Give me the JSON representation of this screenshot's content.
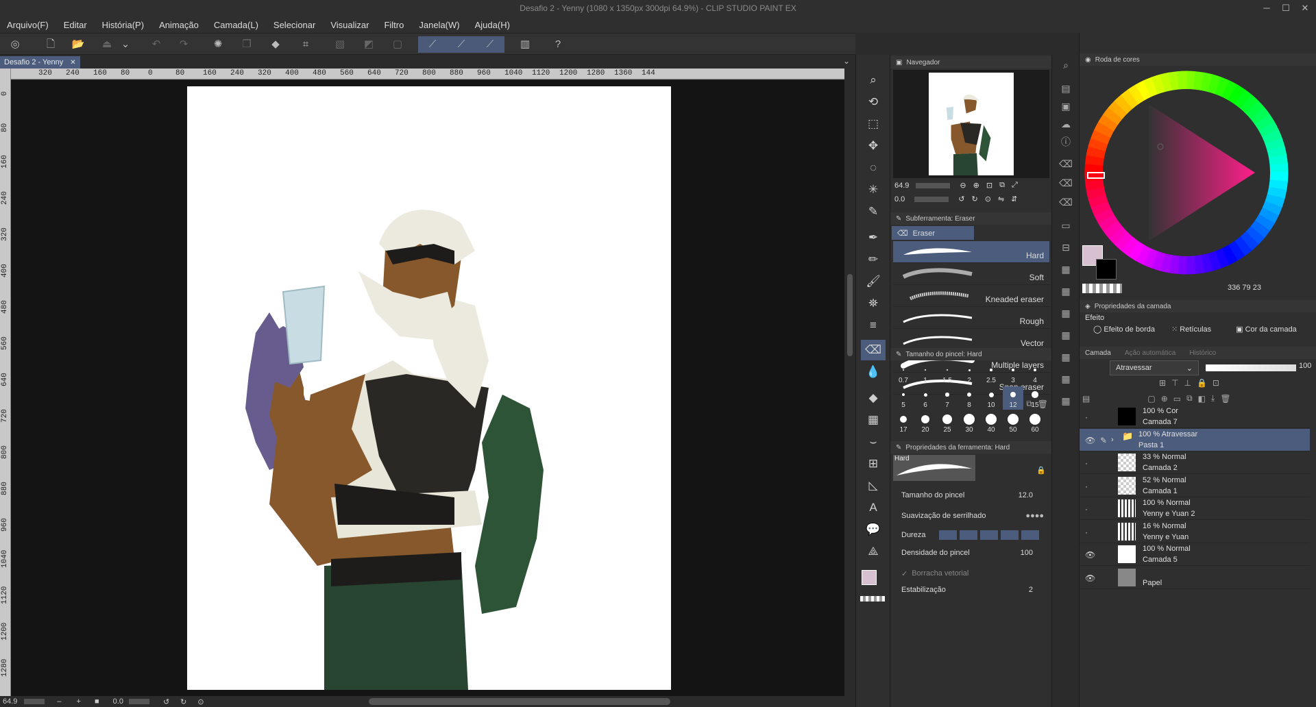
{
  "app": {
    "title": "Desafio 2 - Yenny (1080 x 1350px 300dpi 64.9%) - CLIP STUDIO PAINT EX"
  },
  "window_controls": {
    "minimize": "─",
    "maximize": "☐",
    "close": "✕"
  },
  "menu": [
    "Arquivo(F)",
    "Editar",
    "História(P)",
    "Animação",
    "Camada(L)",
    "Selecionar",
    "Visualizar",
    "Filtro",
    "Janela(W)",
    "Ajuda(H)"
  ],
  "document_tab": {
    "label": "Desafio 2 - Yenny",
    "close": "✕"
  },
  "ruler": {
    "h_labels": [
      "320",
      "240",
      "160",
      "80",
      "0",
      "80",
      "160",
      "240",
      "320",
      "400",
      "480",
      "560",
      "640",
      "720",
      "800",
      "880",
      "960",
      "1040",
      "1120",
      "1200",
      "1280",
      "1360",
      "144"
    ],
    "v_labels": [
      "0",
      "80",
      "160",
      "240",
      "320",
      "400",
      "480",
      "560",
      "640",
      "720",
      "800",
      "880",
      "960",
      "1040",
      "1120",
      "1200",
      "1280"
    ]
  },
  "status": {
    "zoom": "64.9",
    "minus": "–",
    "plus": "+",
    "angle": "0.0"
  },
  "navigator": {
    "title": "Navegador",
    "zoom": "64.9",
    "rotation": "0.0"
  },
  "subtool": {
    "title": "Subferramenta: Eraser",
    "group": "Eraser",
    "items": [
      "Hard",
      "Soft",
      "Kneaded eraser",
      "Rough",
      "Vector",
      "Multiple layers",
      "Snap eraser"
    ]
  },
  "brush_size": {
    "title": "Tamanho do pincel: Hard",
    "sizes": [
      "0.7",
      "1",
      "1.5",
      "2",
      "2.5",
      "3",
      "4",
      "5",
      "6",
      "7",
      "8",
      "10",
      "12",
      "15",
      "17",
      "20",
      "25",
      "30",
      "40",
      "50",
      "60"
    ],
    "selected": "12"
  },
  "tool_props": {
    "title": "Propriedades da ferramenta: Hard",
    "preview_label": "Hard",
    "brush_size_label": "Tamanho do pincel",
    "brush_size_value": "12.0",
    "antialias_label": "Suavização de serrilhado",
    "hardness_label": "Dureza",
    "density_label": "Densidade do pincel",
    "density_value": "100",
    "vector_label": "Borracha vetorial",
    "stabilization_label": "Estabilização",
    "stabilization_value": "2"
  },
  "color_wheel": {
    "title": "Roda de cores",
    "readout": "336  79  23",
    "main_color": "#d7c0cf",
    "sub_color": "#000000"
  },
  "layer_props": {
    "title": "Propriedades da camada",
    "effect_label": "Efeito",
    "border": "Efeito de borda",
    "screentone": "Retículas",
    "layer_color": "Cor da camada"
  },
  "layer_panel": {
    "tabs": [
      "Camada",
      "Ação automática",
      "Histórico"
    ],
    "blend_mode": "Atravessar",
    "opacity": "100",
    "layers": [
      {
        "mode": "100 % Cor",
        "name": "Camada 7",
        "visible": false,
        "thumb": "black"
      },
      {
        "mode": "100 % Atravessar",
        "name": "Pasta 1",
        "visible": true,
        "thumb": "folder",
        "selected": true
      },
      {
        "mode": "33 % Normal",
        "name": "Camada 2",
        "visible": false,
        "thumb": "checker"
      },
      {
        "mode": "52 % Normal",
        "name": "Camada 1",
        "visible": false,
        "thumb": "checker"
      },
      {
        "mode": "100 % Normal",
        "name": "Yenny e Yuan 2",
        "visible": false,
        "thumb": "sketch"
      },
      {
        "mode": "16 % Normal",
        "name": "Yenny e Yuan",
        "visible": false,
        "thumb": "sketch"
      },
      {
        "mode": "100 % Normal",
        "name": "Camada 5",
        "visible": true,
        "thumb": "white"
      },
      {
        "mode": "",
        "name": "Papel",
        "visible": true,
        "thumb": "gray"
      }
    ]
  }
}
